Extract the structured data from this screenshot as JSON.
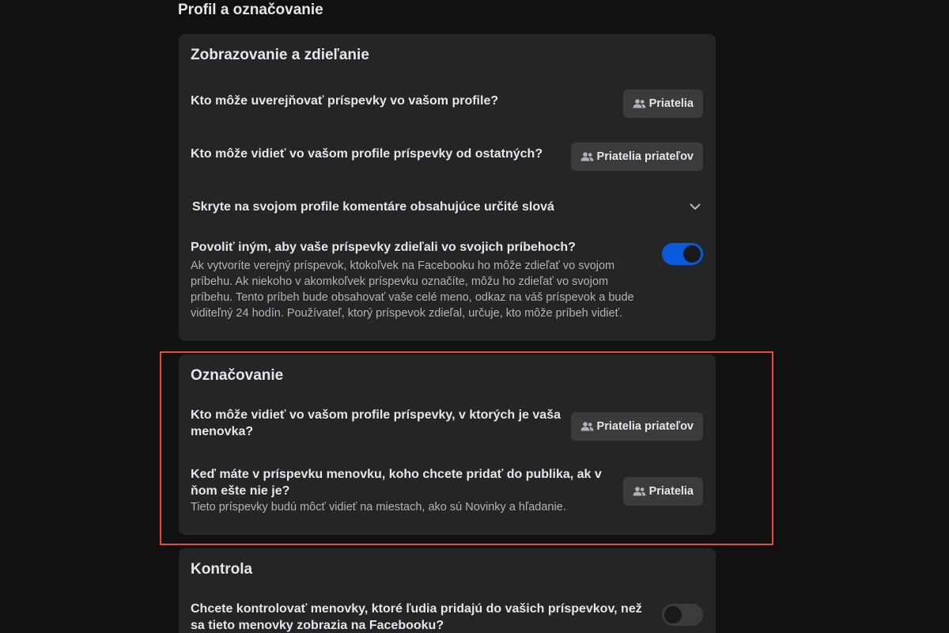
{
  "page_title": "Profil a označovanie",
  "sections": {
    "viewing": {
      "title": "Zobrazovanie a zdieľanie",
      "row1": {
        "question": "Kto môže uverejňovať príspevky vo vašom profile?",
        "button_label": "Priatelia",
        "button_icon": "friends-icon"
      },
      "row2": {
        "question": "Kto môže vidieť vo vašom profile príspevky od ostatných?",
        "button_label": "Priatelia priateľov",
        "button_icon": "friends-icon"
      },
      "row3": {
        "question": "Skryte na svojom profile komentáre obsahujúce určité slová",
        "control_icon": "chevron-down-icon"
      },
      "row4": {
        "question": "Povoliť iným, aby vaše príspevky zdieľali vo svojich príbehoch?",
        "description": "Ak vytvoríte verejný príspevok, ktokoľvek na Facebooku ho môže zdieľať vo svojom príbehu. Ak niekoho v akomkoľvek príspevku označíte, môžu ho zdieľať vo svojom príbehu. Tento príbeh bude obsahovať vaše celé meno, odkaz na váš príspevok a bude viditeľný 24 hodín. Používateľ, ktorý príspevok zdieľal, určuje, kto môže príbeh vidieť.",
        "toggle_on": true
      }
    },
    "tagging": {
      "title": "Označovanie",
      "row1": {
        "question": "Kto môže vidieť vo vašom profile príspevky, v ktorých je vaša menovka?",
        "button_label": "Priatelia priateľov",
        "button_icon": "friends-icon"
      },
      "row2": {
        "question": "Keď máte v príspevku menovku, koho chcete pridať do publika, ak v ňom ešte nie je?",
        "description": "Tieto príspevky budú môcť vidieť na miestach, ako sú Novinky a hľadanie.",
        "button_label": "Priatelia",
        "button_icon": "friends-icon"
      }
    },
    "review": {
      "title": "Kontrola",
      "row1": {
        "question": "Chcete kontrolovať menovky, ktoré ľudia pridajú do vašich príspevkov, než sa tieto menovky zobrazia na Facebooku?",
        "toggle_on": false
      }
    }
  },
  "colors": {
    "background": "#111111",
    "card": "#242526",
    "button": "#3a3b3c",
    "toggle_on": "#0b5ad9",
    "highlight": "#e4512d"
  }
}
